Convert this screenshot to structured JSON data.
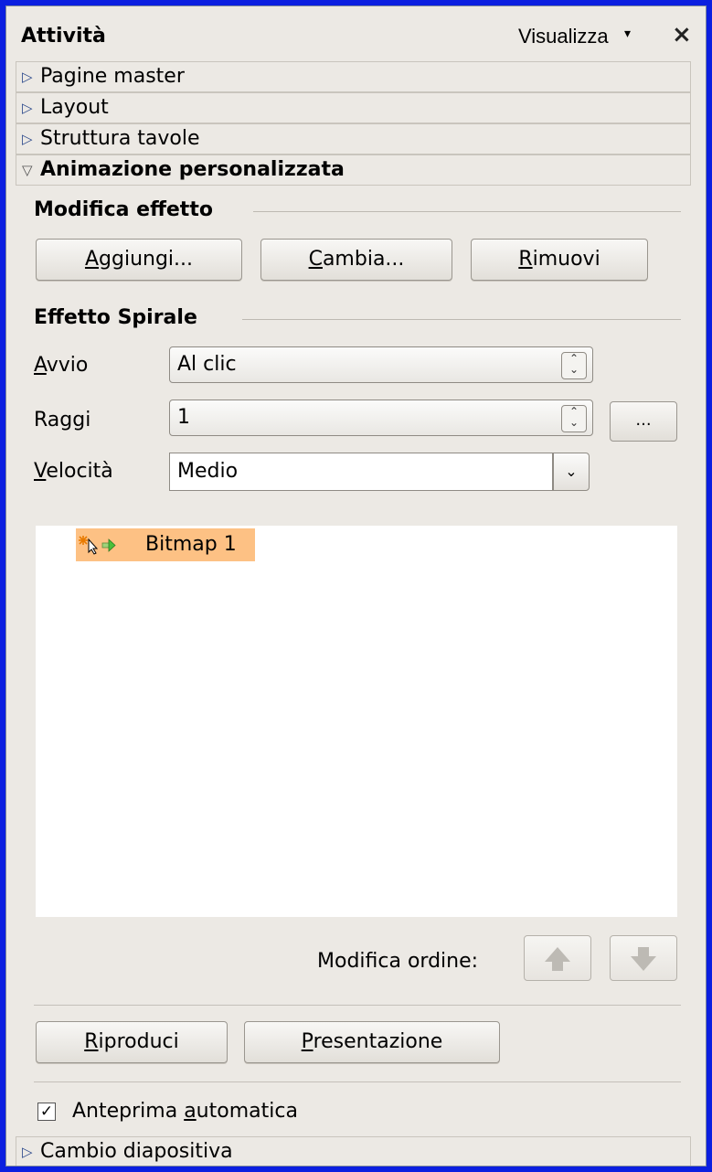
{
  "panel": {
    "title": "Attività",
    "view_menu": "Visualizza",
    "view_arrow": "▾",
    "close": "×"
  },
  "sections": {
    "master_pages": "Pagine master",
    "layout": "Layout",
    "table_design": "Struttura tavole",
    "custom_animation": "Animazione personalizzata",
    "slide_transition": "Cambio diapositiva"
  },
  "modify_effect": {
    "heading": "Modifica effetto",
    "add_access": "A",
    "add_rest": "ggiungi...",
    "change_access": "C",
    "change_rest": "ambia...",
    "remove_access": "R",
    "remove_rest": "imuovi"
  },
  "effect": {
    "heading": "Effetto Spirale",
    "start_label_access": "A",
    "start_label_rest": "vvio",
    "start_value": "Al clic",
    "rays_label": "Raggi",
    "rays_value": "1",
    "more_button": "...",
    "speed_label_access": "V",
    "speed_label_rest": "elocità",
    "speed_value": "Medio"
  },
  "animation_list": {
    "items": [
      {
        "label": "Bitmap 1",
        "icon": "on-click-animation-icon",
        "selected": true
      }
    ]
  },
  "order": {
    "label": "Modifica ordine:",
    "up_icon": "arrow-up-icon",
    "down_icon": "arrow-down-icon"
  },
  "playback": {
    "play_access": "R",
    "play_rest": "iproduci",
    "slideshow_access": "P",
    "slideshow_rest": "resentazione"
  },
  "preview": {
    "label_pre": "Anteprima ",
    "label_access": "a",
    "label_rest": "utomatica",
    "checked": true,
    "check_mark": "✓"
  },
  "colors": {
    "selection": "#fdc184",
    "window_border": "#0b1fe0",
    "panel_bg": "#ece9e4"
  }
}
